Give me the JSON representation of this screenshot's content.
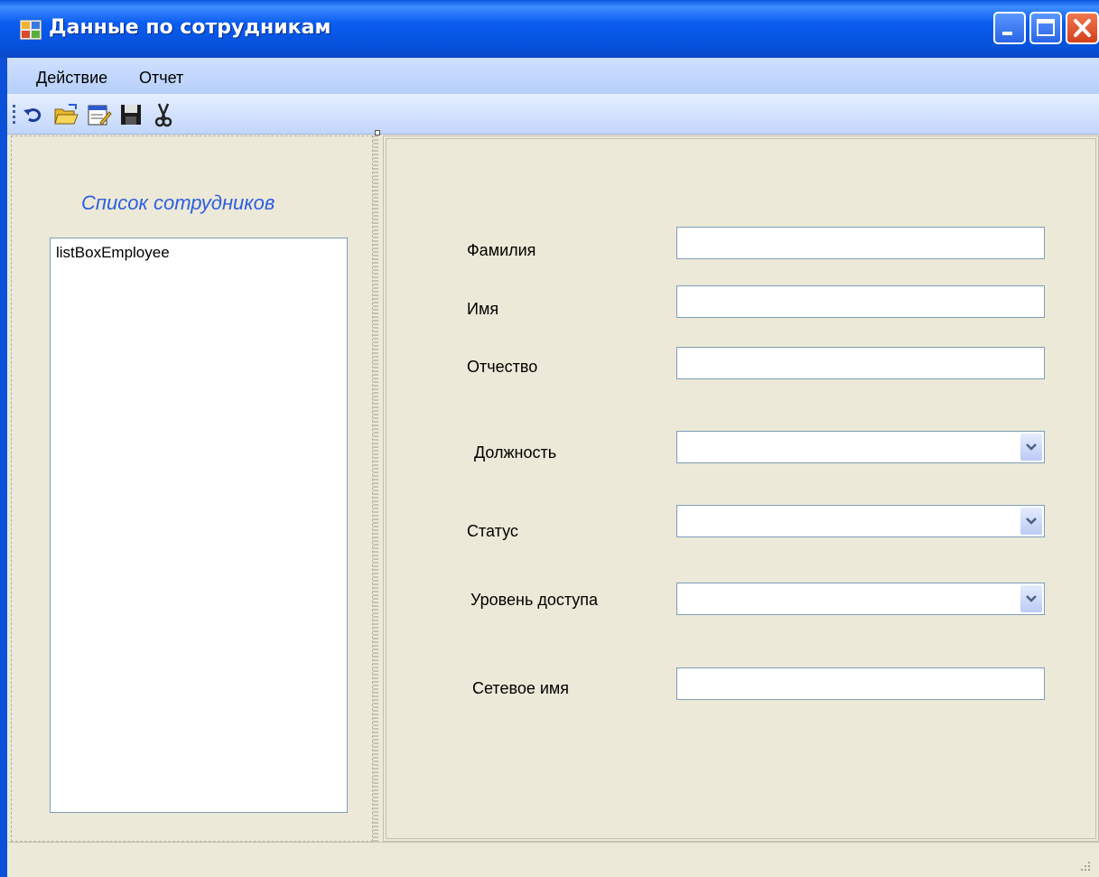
{
  "window": {
    "title": "Данные по сотрудникам"
  },
  "menu": {
    "items": [
      "Действие",
      "Отчет"
    ]
  },
  "toolbar": {
    "icons": [
      "undo-icon",
      "open-folder-icon",
      "edit-icon",
      "save-icon",
      "cut-icon"
    ]
  },
  "left_panel": {
    "title": "Список сотрудников",
    "listbox_text": "listBoxEmployee"
  },
  "form": {
    "last_name_label": "Фамилия",
    "first_name_label": "Имя",
    "patronymic_label": "Отчество",
    "position_label": "Должность",
    "status_label": "Статус",
    "access_level_label": "Уровень доступа",
    "network_name_label": "Сетевое имя",
    "last_name_value": "",
    "first_name_value": "",
    "patronymic_value": "",
    "position_value": "",
    "status_value": "",
    "access_level_value": "",
    "network_name_value": ""
  },
  "colors": {
    "titlebar": "#0a5cf0",
    "window_bg": "#ece9d8",
    "list_title": "#2d5ee0",
    "close_button": "#d2401c"
  }
}
